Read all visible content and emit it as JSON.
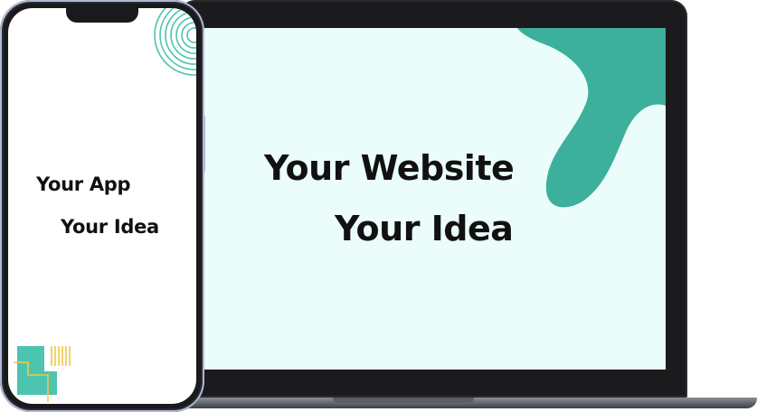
{
  "laptop": {
    "line_1": "Your Website",
    "line_2": "Your Idea"
  },
  "phone": {
    "line_1": "Your App",
    "line_2": "Your Idea"
  },
  "colors": {
    "accent_teal": "#3cb09c",
    "screen_bg": "#ebfdfb",
    "ring_teal": "#4cc4b0",
    "deco_yellow": "#f0c94a",
    "device_frame": "#1b1b1d",
    "phone_rim": "#aeb9d9"
  }
}
